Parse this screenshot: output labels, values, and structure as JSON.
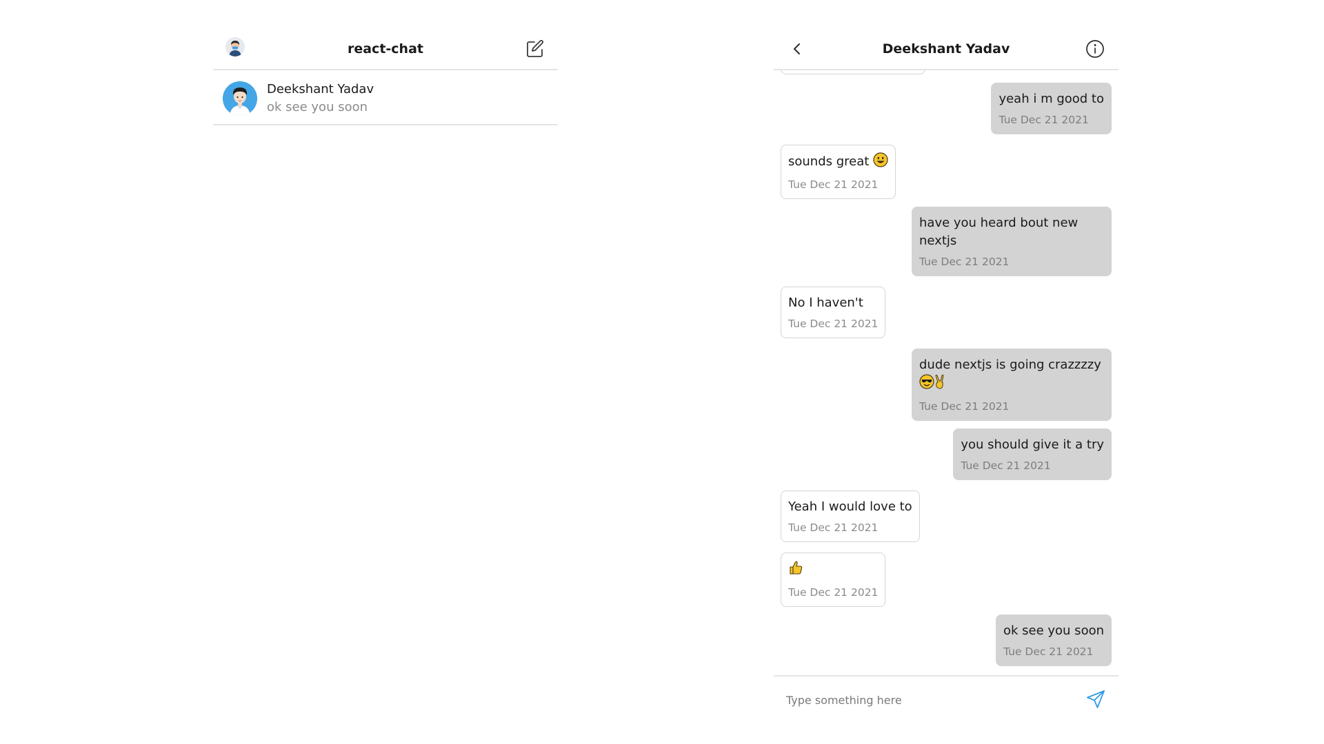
{
  "app": {
    "title": "react-chat",
    "accent_color": "#2f9be6"
  },
  "sidebar": {
    "avatar_icon": "user-avatar-icon",
    "compose_icon": "compose-icon",
    "conversations": [
      {
        "name": "Deekshant Yadav",
        "last_message": "ok see you soon",
        "avatar_color": "#44a6e6"
      }
    ]
  },
  "chat": {
    "contact_name": "Deekshant Yadav",
    "back_icon": "chevron-left-icon",
    "info_icon": "info-icon",
    "messages": [
      {
        "direction": "in",
        "text": "",
        "time": ""
      },
      {
        "direction": "out",
        "text": "yeah i m good to",
        "time": "Tue Dec 21 2021"
      },
      {
        "direction": "in",
        "text": "sounds great",
        "emoji": "smile-emoji",
        "time": "Tue Dec 21 2021"
      },
      {
        "direction": "out",
        "text": "have you heard bout new nextjs",
        "time": "Tue Dec 21 2021"
      },
      {
        "direction": "in",
        "text": "No I haven't",
        "time": "Tue Dec 21 2021"
      },
      {
        "direction": "out",
        "text": "dude nextjs is going crazzzzy",
        "emoji": "sunglasses-and-victory-emoji",
        "time": "Tue Dec 21 2021"
      },
      {
        "direction": "out",
        "text": "you should give it a try",
        "time": "Tue Dec 21 2021"
      },
      {
        "direction": "in",
        "text": "Yeah I would love to",
        "time": "Tue Dec 21 2021"
      },
      {
        "direction": "in",
        "text": "",
        "emoji": "thumbs-up-emoji",
        "time": "Tue Dec 21 2021"
      },
      {
        "direction": "out",
        "text": "ok see you soon",
        "time": "Tue Dec 21 2021"
      }
    ],
    "composer": {
      "placeholder": "Type something here",
      "value": "",
      "send_icon": "send-icon"
    }
  }
}
